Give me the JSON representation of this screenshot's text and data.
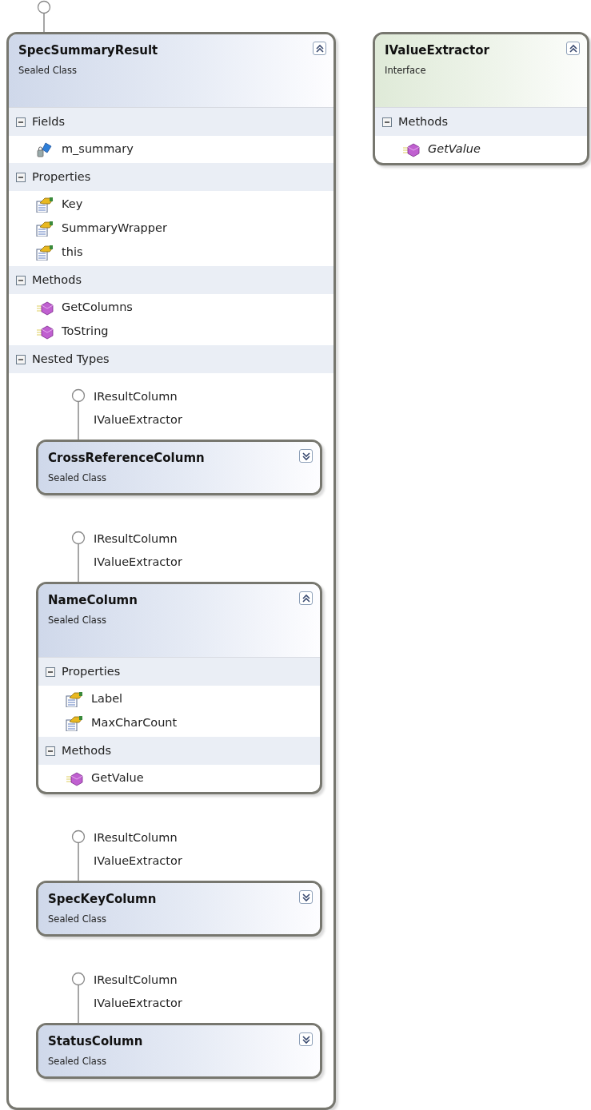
{
  "types": [
    {
      "name": "SpecSummaryResult",
      "stereotype": "Sealed Class",
      "kind": "class",
      "expanded": true,
      "lollipop": true,
      "compartments": [
        {
          "title": "Fields",
          "expanded": true,
          "members": [
            {
              "name": "m_summary",
              "kind": "field",
              "abstract": false
            }
          ]
        },
        {
          "title": "Properties",
          "expanded": true,
          "members": [
            {
              "name": "Key",
              "kind": "property",
              "abstract": false
            },
            {
              "name": "SummaryWrapper",
              "kind": "property",
              "abstract": false
            },
            {
              "name": "this",
              "kind": "property",
              "abstract": false
            }
          ]
        },
        {
          "title": "Methods",
          "expanded": true,
          "members": [
            {
              "name": "GetColumns",
              "kind": "method",
              "abstract": false
            },
            {
              "name": "ToString",
              "kind": "method",
              "abstract": false
            }
          ]
        },
        {
          "title": "Nested Types",
          "expanded": true,
          "nested": [
            {
              "interfaces": [
                "IResultColumn",
                "IValueExtractor"
              ],
              "name": "CrossReferenceColumn",
              "stereotype": "Sealed Class",
              "kind": "class",
              "expanded": false
            },
            {
              "interfaces": [
                "IResultColumn",
                "IValueExtractor"
              ],
              "name": "NameColumn",
              "stereotype": "Sealed Class",
              "kind": "class",
              "expanded": true,
              "compartments": [
                {
                  "title": "Properties",
                  "expanded": true,
                  "members": [
                    {
                      "name": "Label",
                      "kind": "property",
                      "abstract": false
                    },
                    {
                      "name": "MaxCharCount",
                      "kind": "property",
                      "abstract": false
                    }
                  ]
                },
                {
                  "title": "Methods",
                  "expanded": true,
                  "members": [
                    {
                      "name": "GetValue",
                      "kind": "method",
                      "abstract": false
                    }
                  ]
                }
              ]
            },
            {
              "interfaces": [
                "IResultColumn",
                "IValueExtractor"
              ],
              "name": "SpecKeyColumn",
              "stereotype": "Sealed Class",
              "kind": "class",
              "expanded": false
            },
            {
              "interfaces": [
                "IResultColumn",
                "IValueExtractor"
              ],
              "name": "StatusColumn",
              "stereotype": "Sealed Class",
              "kind": "class",
              "expanded": false
            }
          ]
        }
      ]
    },
    {
      "name": "IValueExtractor",
      "stereotype": "Interface",
      "kind": "interface",
      "expanded": true,
      "lollipop": false,
      "compartments": [
        {
          "title": "Methods",
          "expanded": true,
          "members": [
            {
              "name": "GetValue",
              "kind": "method",
              "abstract": true
            }
          ]
        }
      ]
    }
  ]
}
